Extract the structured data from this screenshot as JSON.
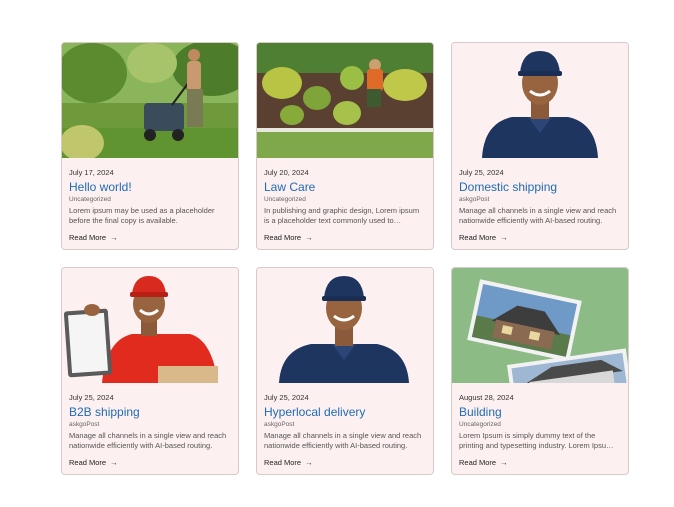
{
  "posts": [
    {
      "date": "July 17, 2024",
      "title": "Hello world!",
      "category": "Uncategorized",
      "excerpt": "Lorem ipsum may be used as a placeholder before the final copy is available.",
      "read_more": "Read More",
      "image": "lawn-mower-photo"
    },
    {
      "date": "July 20, 2024",
      "title": "Law Care",
      "category": "Uncategorized",
      "excerpt": "In publishing and graphic design, Lorem ipsum is a placeholder text commonly used to demonstrate the visual form.",
      "read_more": "Read More",
      "image": "gardener-hedge-photo"
    },
    {
      "date": "July 25, 2024",
      "title": "Domestic shipping",
      "category": "askgoPost",
      "excerpt": "Manage all channels in a single view and reach nationwide efficiently with AI-based routing.",
      "read_more": "Read More",
      "image": "courier-navy-photo"
    },
    {
      "date": "July 25, 2024",
      "title": "B2B shipping",
      "category": "askgoPost",
      "excerpt": "Manage all channels in a single view and reach nationwide efficiently with AI-based routing.",
      "read_more": "Read More",
      "image": "courier-red-clipboard-photo"
    },
    {
      "date": "July 25, 2024",
      "title": "Hyperlocal delivery",
      "category": "askgoPost",
      "excerpt": "Manage all channels in a single view and reach nationwide efficiently with AI-based routing.",
      "read_more": "Read More",
      "image": "courier-navy-photo"
    },
    {
      "date": "August 28, 2024",
      "title": "Building",
      "category": "Uncategorized",
      "excerpt": "Lorem Ipsum is simply dummy text of the printing and typesetting industry. Lorem Ipsum has been the standard.",
      "read_more": "Read More",
      "image": "house-postcards-photo"
    }
  ]
}
